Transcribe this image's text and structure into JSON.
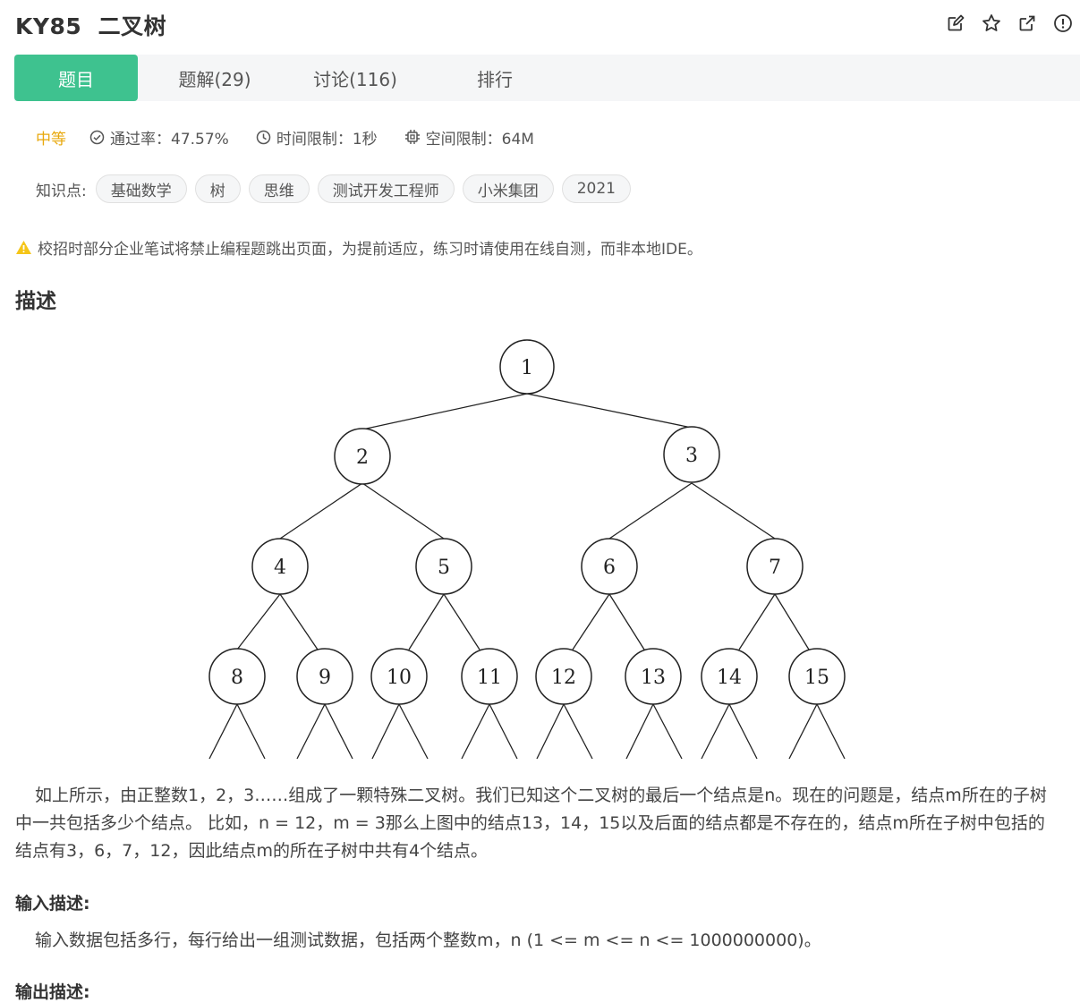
{
  "header": {
    "title": "KY85  二叉树",
    "icons": [
      "edit-icon",
      "star-icon",
      "external-link-icon",
      "report-icon"
    ]
  },
  "tabs": [
    {
      "label": "题目",
      "active": true
    },
    {
      "label": "题解(29)",
      "active": false
    },
    {
      "label": "讨论(116)",
      "active": false
    },
    {
      "label": "排行",
      "active": false
    }
  ],
  "meta": {
    "difficulty": "中等",
    "pass_rate": "通过率：47.57%",
    "time_limit": "时间限制：1秒",
    "memory_limit": "空间限制：64M"
  },
  "tags_label": "知识点:",
  "tags": [
    "基础数学",
    "树",
    "思维",
    "测试开发工程师",
    "小米集团",
    "2021"
  ],
  "notice": "校招时部分企业笔试将禁止编程题跳出页面，为提前适应，练习时请使用在线自测，而非本地IDE。",
  "description": {
    "heading": "描述",
    "tree_nodes": [
      "1",
      "2",
      "3",
      "4",
      "5",
      "6",
      "7",
      "8",
      "9",
      "10",
      "11",
      "12",
      "13",
      "14",
      "15"
    ],
    "text": "如上所示，由正整数1，2，3……组成了一颗特殊二叉树。我们已知这个二叉树的最后一个结点是n。现在的问题是，结点m所在的子树中一共包括多少个结点。     比如，n = 12，m = 3那么上图中的结点13，14，15以及后面的结点都是不存在的，结点m所在子树中包括的结点有3，6，7，12，因此结点m的所在子树中共有4个结点。"
  },
  "input_section": {
    "heading": "输入描述:",
    "text": "输入数据包括多行，每行给出一组测试数据，包括两个整数m，n (1 <= m <= n <= 1000000000)。"
  },
  "output_section": {
    "heading": "输出描述:"
  },
  "colors": {
    "accent": "#3ec28f",
    "difficulty": "#e8a80c",
    "warning": "#f5c518"
  }
}
